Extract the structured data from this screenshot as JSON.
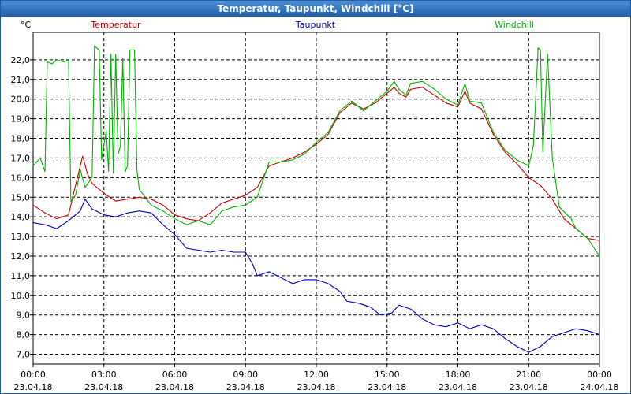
{
  "window": {
    "title": "Temperatur, Taupunkt, Windchill [°C]"
  },
  "chart_data": {
    "type": "line",
    "title": "Temperatur, Taupunkt, Windchill [°C]",
    "ylabel": "°C",
    "ylim": [
      6.5,
      23.4
    ],
    "xlim": [
      "23.04.18 00:00",
      "24.04.18 00:00"
    ],
    "grid": true,
    "legend": "top",
    "yticks": [
      "7,0",
      "8,0",
      "9,0",
      "10,0",
      "11,0",
      "12,0",
      "13,0",
      "14,0",
      "15,0",
      "16,0",
      "17,0",
      "18,0",
      "19,0",
      "20,0",
      "21,0",
      "22,0"
    ],
    "xticks": [
      {
        "h": 0,
        "time": "00:00",
        "date": "23.04.18"
      },
      {
        "h": 3,
        "time": "03:00",
        "date": "23.04.18"
      },
      {
        "h": 6,
        "time": "06:00",
        "date": "23.04.18"
      },
      {
        "h": 9,
        "time": "09:00",
        "date": "23.04.18"
      },
      {
        "h": 12,
        "time": "12:00",
        "date": "23.04.18"
      },
      {
        "h": 15,
        "time": "15:00",
        "date": "23.04.18"
      },
      {
        "h": 18,
        "time": "18:00",
        "date": "23.04.18"
      },
      {
        "h": 21,
        "time": "21:00",
        "date": "23.04.18"
      },
      {
        "h": 24,
        "time": "00:00",
        "date": "24.04.18"
      }
    ],
    "series": [
      {
        "name": "Temperatur",
        "color": "#cc0000",
        "points": [
          [
            0,
            14.6
          ],
          [
            0.5,
            14.2
          ],
          [
            1,
            13.9
          ],
          [
            1.5,
            14.1
          ],
          [
            1.8,
            15.6
          ],
          [
            2,
            16.6
          ],
          [
            2.1,
            17.1
          ],
          [
            2.3,
            16.2
          ],
          [
            2.5,
            15.7
          ],
          [
            3,
            15.2
          ],
          [
            3.5,
            14.8
          ],
          [
            4,
            14.9
          ],
          [
            4.5,
            15.0
          ],
          [
            5,
            14.9
          ],
          [
            5.5,
            14.6
          ],
          [
            6,
            14.1
          ],
          [
            6.5,
            13.9
          ],
          [
            7,
            13.8
          ],
          [
            7.5,
            14.2
          ],
          [
            8,
            14.7
          ],
          [
            8.5,
            14.9
          ],
          [
            9,
            15.1
          ],
          [
            9.5,
            15.5
          ],
          [
            10,
            16.6
          ],
          [
            10.5,
            16.8
          ],
          [
            11,
            17.0
          ],
          [
            11.5,
            17.3
          ],
          [
            12,
            17.7
          ],
          [
            12.5,
            18.2
          ],
          [
            13,
            19.3
          ],
          [
            13.5,
            19.8
          ],
          [
            14,
            19.5
          ],
          [
            14.5,
            19.8
          ],
          [
            15,
            20.3
          ],
          [
            15.3,
            20.6
          ],
          [
            15.5,
            20.3
          ],
          [
            15.8,
            20.1
          ],
          [
            16,
            20.5
          ],
          [
            16.5,
            20.6
          ],
          [
            17,
            20.2
          ],
          [
            17.5,
            19.8
          ],
          [
            18,
            19.6
          ],
          [
            18.3,
            20.4
          ],
          [
            18.5,
            19.8
          ],
          [
            19,
            19.5
          ],
          [
            19.5,
            18.2
          ],
          [
            20,
            17.3
          ],
          [
            20.5,
            16.7
          ],
          [
            21,
            16.0
          ],
          [
            21.5,
            15.6
          ],
          [
            22,
            14.9
          ],
          [
            22.5,
            13.9
          ],
          [
            23,
            13.4
          ],
          [
            23.5,
            12.9
          ],
          [
            24,
            12.8
          ]
        ]
      },
      {
        "name": "Taupunkt",
        "color": "#0000c8",
        "points": [
          [
            0,
            13.7
          ],
          [
            0.5,
            13.6
          ],
          [
            1,
            13.4
          ],
          [
            1.5,
            13.8
          ],
          [
            2,
            14.3
          ],
          [
            2.2,
            14.9
          ],
          [
            2.5,
            14.4
          ],
          [
            3,
            14.1
          ],
          [
            3.5,
            14.0
          ],
          [
            4,
            14.2
          ],
          [
            4.5,
            14.3
          ],
          [
            5,
            14.2
          ],
          [
            5.5,
            13.6
          ],
          [
            6,
            13.1
          ],
          [
            6.5,
            12.4
          ],
          [
            7,
            12.3
          ],
          [
            7.5,
            12.2
          ],
          [
            8,
            12.3
          ],
          [
            8.5,
            12.2
          ],
          [
            9,
            12.2
          ],
          [
            9.3,
            11.6
          ],
          [
            9.5,
            11.0
          ],
          [
            10,
            11.2
          ],
          [
            10.5,
            10.9
          ],
          [
            11,
            10.6
          ],
          [
            11.5,
            10.8
          ],
          [
            12,
            10.8
          ],
          [
            12.5,
            10.6
          ],
          [
            13,
            10.2
          ],
          [
            13.3,
            9.7
          ],
          [
            13.8,
            9.6
          ],
          [
            14.3,
            9.4
          ],
          [
            14.7,
            9.0
          ],
          [
            15.2,
            9.1
          ],
          [
            15.5,
            9.5
          ],
          [
            16,
            9.3
          ],
          [
            16.5,
            8.8
          ],
          [
            17,
            8.5
          ],
          [
            17.5,
            8.4
          ],
          [
            18,
            8.6
          ],
          [
            18.5,
            8.3
          ],
          [
            19,
            8.5
          ],
          [
            19.5,
            8.3
          ],
          [
            20,
            7.8
          ],
          [
            20.5,
            7.4
          ],
          [
            21,
            7.1
          ],
          [
            21.5,
            7.4
          ],
          [
            22,
            7.9
          ],
          [
            22.5,
            8.1
          ],
          [
            23,
            8.3
          ],
          [
            23.5,
            8.2
          ],
          [
            24,
            8.0
          ]
        ]
      },
      {
        "name": "Windchill",
        "color": "#00b400",
        "points": [
          [
            0,
            16.6
          ],
          [
            0.3,
            17.0
          ],
          [
            0.5,
            16.3
          ],
          [
            0.6,
            21.9
          ],
          [
            0.8,
            21.8
          ],
          [
            1,
            22.0
          ],
          [
            1.3,
            21.9
          ],
          [
            1.5,
            22.0
          ],
          [
            1.6,
            14.8
          ],
          [
            1.8,
            15.1
          ],
          [
            2,
            16.4
          ],
          [
            2.2,
            15.5
          ],
          [
            2.5,
            16.0
          ],
          [
            2.6,
            22.7
          ],
          [
            2.8,
            22.5
          ],
          [
            2.9,
            16.9
          ],
          [
            3.1,
            18.4
          ],
          [
            3.2,
            16.3
          ],
          [
            3.3,
            22.3
          ],
          [
            3.4,
            16.2
          ],
          [
            3.5,
            22.3
          ],
          [
            3.6,
            17.2
          ],
          [
            3.7,
            17.6
          ],
          [
            3.8,
            22.1
          ],
          [
            3.9,
            16.3
          ],
          [
            4,
            16.6
          ],
          [
            4.1,
            22.5
          ],
          [
            4.3,
            22.5
          ],
          [
            4.4,
            16.4
          ],
          [
            4.5,
            15.4
          ],
          [
            5,
            14.6
          ],
          [
            5.5,
            14.3
          ],
          [
            6,
            13.9
          ],
          [
            6.5,
            13.6
          ],
          [
            7,
            13.8
          ],
          [
            7.5,
            13.6
          ],
          [
            7.8,
            14.0
          ],
          [
            8,
            14.3
          ],
          [
            8.5,
            14.5
          ],
          [
            9,
            14.6
          ],
          [
            9.5,
            15.0
          ],
          [
            10,
            16.8
          ],
          [
            10.5,
            16.8
          ],
          [
            11,
            16.9
          ],
          [
            11.5,
            17.2
          ],
          [
            12,
            17.8
          ],
          [
            12.5,
            18.3
          ],
          [
            13,
            19.4
          ],
          [
            13.5,
            19.9
          ],
          [
            14,
            19.4
          ],
          [
            14.5,
            19.9
          ],
          [
            15,
            20.4
          ],
          [
            15.3,
            20.9
          ],
          [
            15.5,
            20.5
          ],
          [
            15.8,
            20.2
          ],
          [
            16,
            20.8
          ],
          [
            16.5,
            20.9
          ],
          [
            17,
            20.5
          ],
          [
            17.5,
            20.0
          ],
          [
            18,
            19.7
          ],
          [
            18.3,
            20.8
          ],
          [
            18.5,
            19.9
          ],
          [
            19,
            19.8
          ],
          [
            19.5,
            18.3
          ],
          [
            20,
            17.4
          ],
          [
            20.5,
            16.9
          ],
          [
            21,
            16.6
          ],
          [
            21.2,
            17.6
          ],
          [
            21.4,
            22.6
          ],
          [
            21.5,
            22.5
          ],
          [
            21.6,
            17.3
          ],
          [
            21.8,
            22.3
          ],
          [
            22,
            17.0
          ],
          [
            22.3,
            14.5
          ],
          [
            22.8,
            13.9
          ],
          [
            23,
            13.4
          ],
          [
            23.5,
            12.9
          ],
          [
            24,
            12.0
          ]
        ]
      }
    ]
  }
}
